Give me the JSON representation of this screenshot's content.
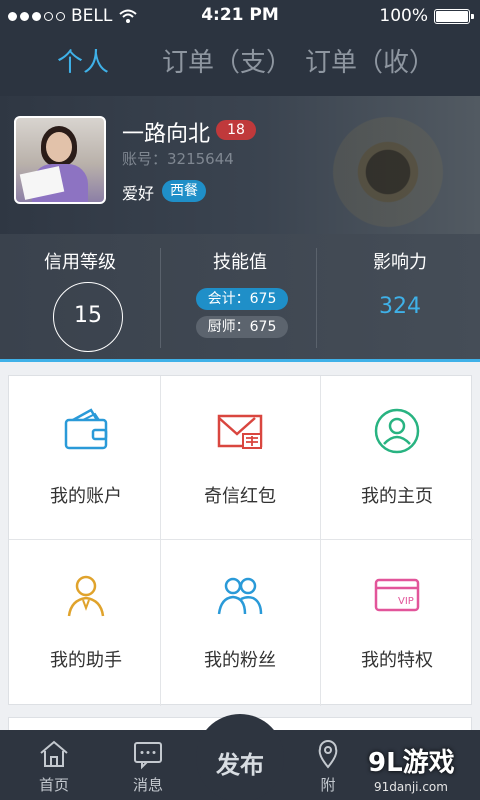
{
  "status_bar": {
    "carrier": "BELL",
    "time": "4:21 PM",
    "battery": "100%",
    "battery_level": 1.0,
    "signal_bars_filled": 3,
    "signal_bars_total": 5
  },
  "tabs": [
    {
      "label": "个人",
      "active": true
    },
    {
      "label": "订单（支）",
      "active": false
    },
    {
      "label": "订单（收）",
      "active": false
    }
  ],
  "profile": {
    "nickname": "一路向北",
    "age": "18",
    "account": "账号：3215644",
    "hobby_label": "爱好",
    "hobby_tag": "西餐"
  },
  "stats": {
    "credit": {
      "title": "信用等级",
      "value": "15"
    },
    "skill": {
      "title": "技能值",
      "items": [
        "会计：675",
        "厨师：675"
      ]
    },
    "influence": {
      "title": "影响力",
      "value": "324"
    }
  },
  "grid": [
    {
      "label": "我的账户",
      "icon": "wallet-icon"
    },
    {
      "label": "奇信红包",
      "icon": "envelope-icon"
    },
    {
      "label": "我的主页",
      "icon": "user-circle-icon"
    },
    {
      "label": "我的助手",
      "icon": "assistant-icon"
    },
    {
      "label": "我的粉丝",
      "icon": "fans-icon"
    },
    {
      "label": "我的特权",
      "icon": "vip-card-icon"
    }
  ],
  "bottom_nav": {
    "home": "首页",
    "messages": "消息",
    "publish": "发布",
    "nearby": "附"
  },
  "watermark": {
    "main": "9L游戏",
    "sub": "91danji.com"
  },
  "colors": {
    "accent": "#3fb1e8",
    "dark_bg": "#2c3440",
    "badge_red": "#c0393b"
  }
}
